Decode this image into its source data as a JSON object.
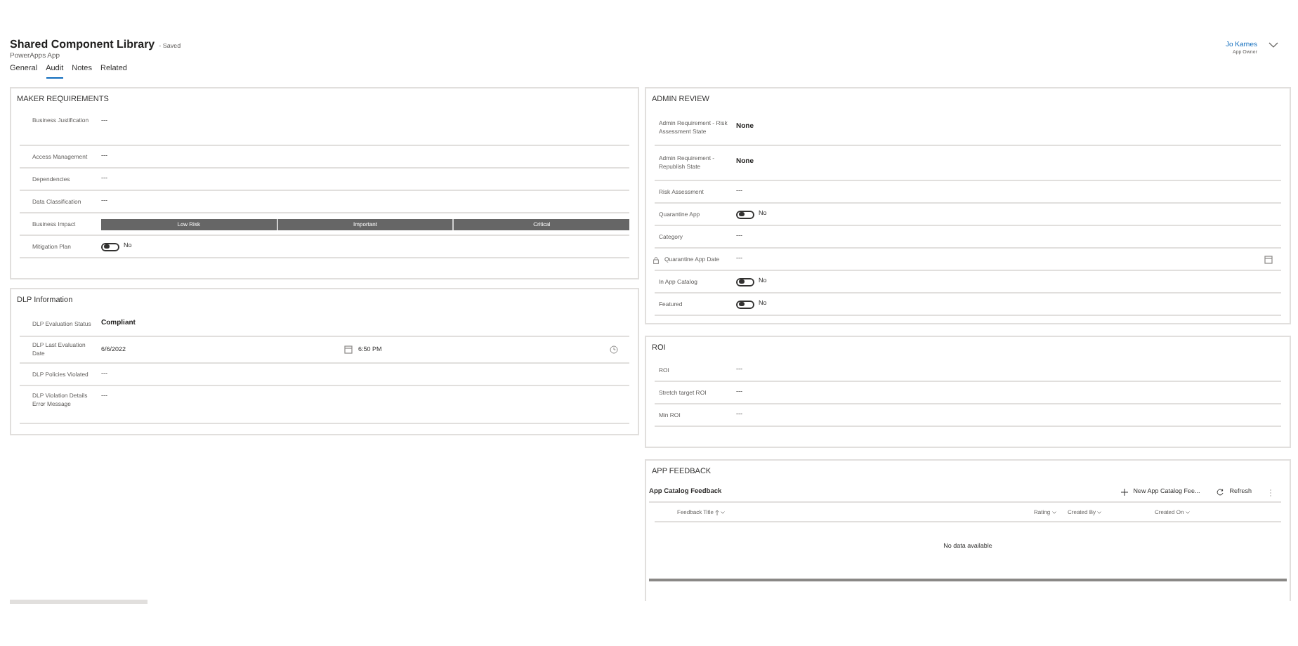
{
  "header": {
    "title": "Shared Component Library",
    "save_status": "- Saved",
    "subtitle": "PowerApps App",
    "user": {
      "name": "Jo Karnes",
      "role": "App Owner"
    }
  },
  "tabs": [
    {
      "label": "General",
      "selected": false
    },
    {
      "label": "Audit",
      "selected": true
    },
    {
      "label": "Notes",
      "selected": false
    },
    {
      "label": "Related",
      "selected": false
    }
  ],
  "left_column": [
    {
      "title": "MAKER REQUIREMENTS",
      "rows": [
        {
          "kind": "multiline",
          "label": "Business Justification",
          "value": "---"
        },
        {
          "kind": "text",
          "label": "Access Management",
          "value": "---"
        },
        {
          "kind": "text",
          "label": "Dependencies",
          "value": "---"
        },
        {
          "kind": "text",
          "label": "Data Classification",
          "value": "---"
        },
        {
          "kind": "segments",
          "label": "Business Impact",
          "options": [
            "Low Risk",
            "Important",
            "Critical"
          ]
        },
        {
          "kind": "toggle",
          "label": "Mitigation Plan",
          "on": false,
          "value": "No"
        }
      ]
    },
    {
      "title": "DLP Information",
      "rows": [
        {
          "kind": "choice",
          "label": "DLP Evaluation Status",
          "value": "Compliant"
        },
        {
          "kind": "datetime",
          "label": "DLP Last Evaluation Date",
          "date": "6/6/2022",
          "time": "6:50 PM"
        },
        {
          "kind": "text",
          "label": "DLP Policies Violated",
          "value": "---"
        },
        {
          "kind": "multiline",
          "label": "DLP Violation Details Error Message",
          "value": "---"
        }
      ]
    }
  ],
  "right_column": [
    {
      "title": "ADMIN REVIEW",
      "rows": [
        {
          "kind": "choice",
          "label": "Admin Requirement - Risk Assessment State",
          "value": "None"
        },
        {
          "kind": "choice",
          "label": "Admin Requirement - Republish State",
          "value": "None"
        },
        {
          "kind": "text",
          "label": "Risk Assessment",
          "value": "---"
        },
        {
          "kind": "toggle",
          "label": "Quarantine App",
          "on": false,
          "value": "No"
        },
        {
          "kind": "text",
          "label": "Category",
          "value": "---"
        },
        {
          "kind": "date",
          "label": "Quarantine App Date",
          "value": "---",
          "locked": true
        },
        {
          "kind": "toggle",
          "label": "In App Catalog",
          "on": false,
          "value": "No"
        },
        {
          "kind": "toggle",
          "label": "Featured",
          "on": false,
          "value": "No"
        }
      ]
    },
    {
      "title": "ROI",
      "rows": [
        {
          "kind": "text",
          "label": "ROI",
          "value": "---"
        },
        {
          "kind": "text",
          "label": "Stretch target ROI",
          "value": "---"
        },
        {
          "kind": "text",
          "label": "Min ROI",
          "value": "---"
        }
      ]
    },
    {
      "title": "APP FEEDBACK",
      "grid": {
        "title": "App Catalog Feedback",
        "commands": [
          {
            "kind": "new",
            "label": "New App Catalog Fee..."
          },
          {
            "kind": "refresh",
            "label": "Refresh"
          },
          {
            "kind": "more"
          }
        ],
        "columns": [
          {
            "label": "Feedback Title",
            "sorted": true
          },
          {
            "label": "Rating",
            "sorted": false
          },
          {
            "label": "Created By",
            "sorted": false
          },
          {
            "label": "Created On",
            "sorted": false
          }
        ],
        "empty_text": "No data available"
      }
    }
  ]
}
